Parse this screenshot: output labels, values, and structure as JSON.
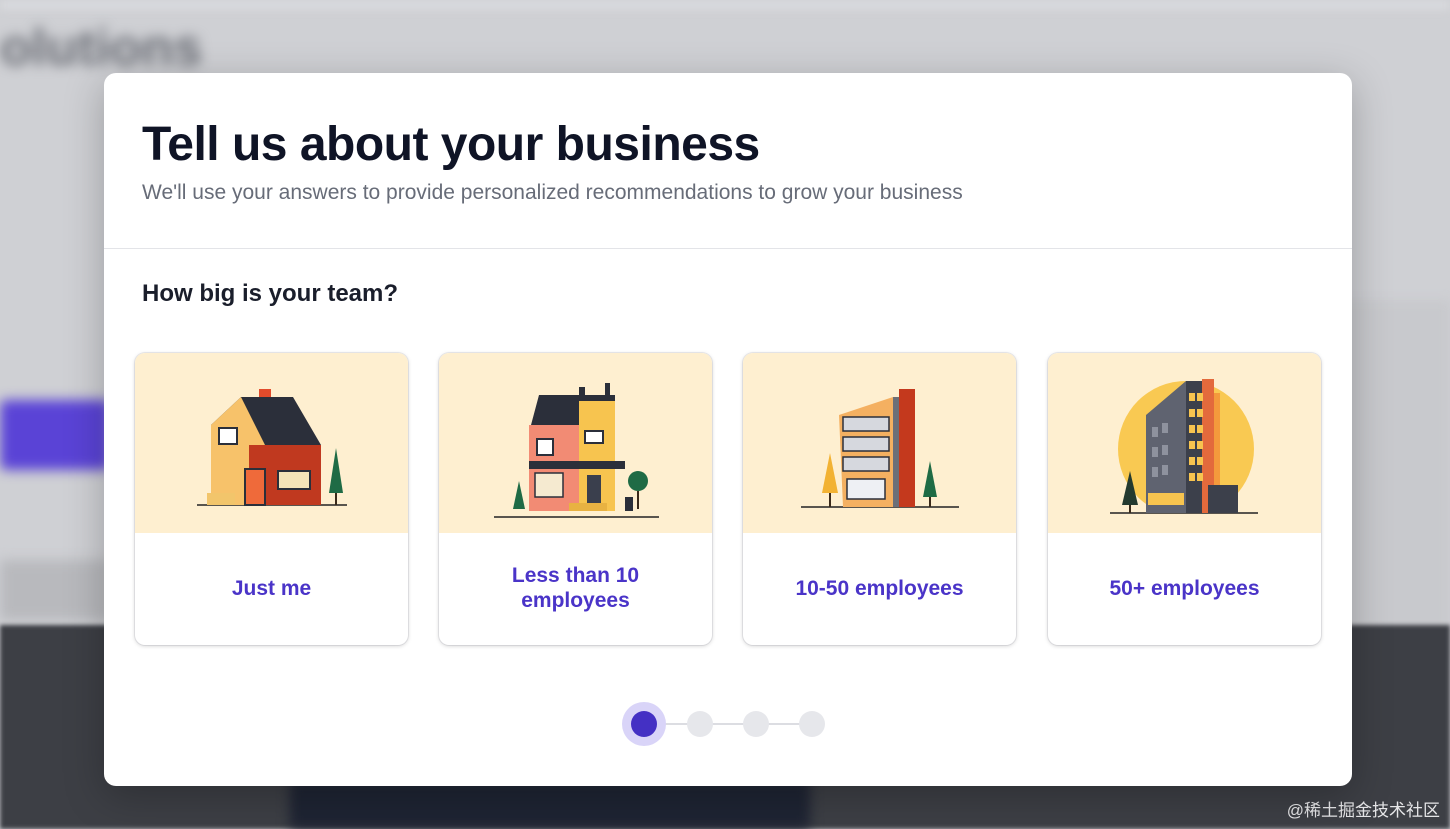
{
  "modal": {
    "title": "Tell us about your business",
    "subtitle": "We'll use your answers to provide personalized recommendations to grow your business"
  },
  "question": "How big is your team?",
  "options": [
    {
      "label": "Just me",
      "icon": "house-icon"
    },
    {
      "label": "Less than 10 employees",
      "icon": "townhouse-icon"
    },
    {
      "label": "10-50 employees",
      "icon": "office-building-icon"
    },
    {
      "label": "50+ employees",
      "icon": "tower-building-icon"
    }
  ],
  "stepper": {
    "total": 4,
    "current": 1
  },
  "watermark": "@稀土掘金技术社区",
  "colors": {
    "accent": "#4a34c8",
    "card_bg": "#feefd0",
    "title": "#0f1426",
    "subtitle": "#676c78"
  }
}
